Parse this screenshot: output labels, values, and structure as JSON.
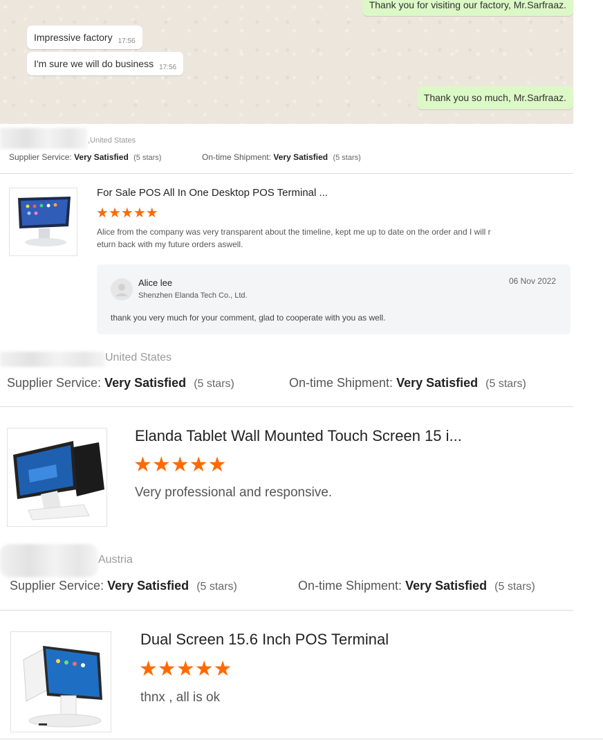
{
  "chat": {
    "messages": [
      {
        "text": "Thank you for visiting our factory, Mr.Sarfraaz.",
        "time": "",
        "dir": "out"
      },
      {
        "text": "Impressive factory",
        "time": "17:56",
        "dir": "in"
      },
      {
        "text": "I'm sure we will do business",
        "time": "17:56",
        "dir": "in"
      },
      {
        "text": "Thank you so much, Mr.Sarfraaz.",
        "time": "",
        "dir": "out"
      }
    ]
  },
  "reviews": [
    {
      "country": ",United States",
      "supplier_label": "Supplier Service:",
      "supplier_value": "Very Satisfied",
      "supplier_count": "(5 stars)",
      "shipment_label": "On-time Shipment:",
      "shipment_value": "Very Satisfied",
      "shipment_count": "(5 stars)",
      "product_title": "For Sale POS All In One Desktop POS Terminal ...",
      "rating": 5,
      "comment_line1": "Alice from the company was very transparent about the timeline, kept me up to date on the order and I will r",
      "comment_line2": "eturn back with my future orders aswell.",
      "reply": {
        "name": "Alice lee",
        "company": "Shenzhen Elanda Tech Co., Ltd.",
        "date": "06 Nov 2022",
        "text": "thank you very much for your comment, glad to cooperate with you as well."
      }
    },
    {
      "country": "United States",
      "supplier_label": "Supplier Service:",
      "supplier_value": "Very Satisfied",
      "supplier_count": "(5 stars)",
      "shipment_label": "On-time Shipment:",
      "shipment_value": "Very Satisfied",
      "shipment_count": "(5 stars)",
      "product_title": "Elanda Tablet Wall Mounted Touch Screen 15 i...",
      "rating": 5,
      "comment": "Very professional and responsive."
    },
    {
      "country": "Austria",
      "supplier_label": "Supplier Service:",
      "supplier_value": "Very Satisfied",
      "supplier_count": "(5 stars)",
      "shipment_label": "On-time Shipment:",
      "shipment_value": "Very Satisfied",
      "shipment_count": "(5 stars)",
      "product_title": "Dual Screen 15.6 Inch POS Terminal",
      "rating": 5,
      "comment": "thnx , all is ok"
    }
  ],
  "icons": {
    "star": "star-icon",
    "avatar": "user-avatar-icon"
  },
  "colors": {
    "star": "#ff6a00",
    "chat_out": "#dcf8c6",
    "chat_bg": "#ede6dd"
  }
}
